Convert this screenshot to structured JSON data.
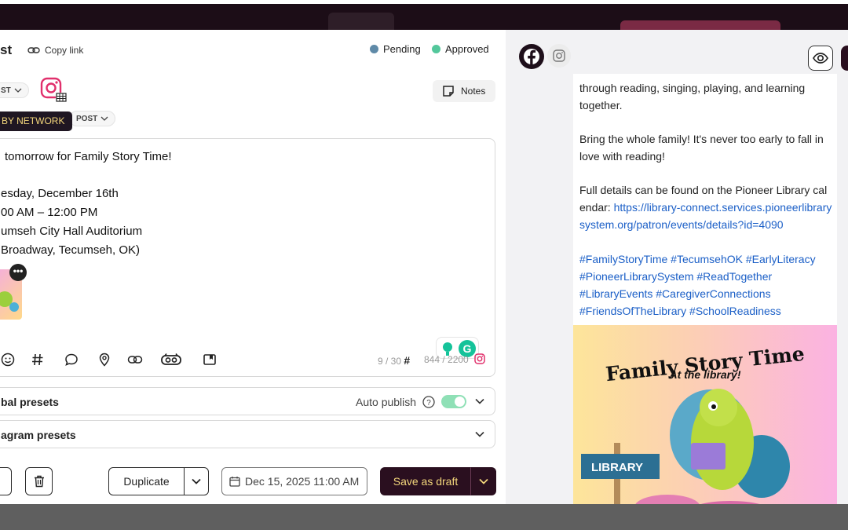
{
  "header": {
    "title_fragment": "st",
    "copy_link": "Copy link",
    "statuses": [
      {
        "label": "Pending",
        "color": "#5f8aa8"
      },
      {
        "label": "Approved",
        "color": "#53c79b"
      }
    ]
  },
  "network_row": {
    "chip_left": "ST",
    "chip_post": "POST",
    "notes": "Notes",
    "tooltip": "BY NETWORK"
  },
  "editor": {
    "lines": [
      "tomorrow for Family Story Time!",
      "esday, December 16th",
      "00 AM – 12:00 PM",
      "umseh City Hall Auditorium",
      "Broadway, Tecumseh, OK)"
    ],
    "hashtag_count": "9 / 30",
    "char_count": "844 / 2200",
    "toolbar_icons": [
      "emoji-icon",
      "hashtag-icon",
      "comment-icon",
      "location-icon",
      "link-icon",
      "ai-assistant-icon",
      "media-library-icon"
    ]
  },
  "presets": {
    "global_label": "bal presets",
    "auto_publish": "Auto publish",
    "auto_publish_on": true,
    "instagram_label": "agram presets"
  },
  "footer": {
    "duplicate": "Duplicate",
    "date": "Dec 15, 2025 11:00 AM",
    "save_draft": "Save as draft"
  },
  "preview": {
    "networks": [
      "facebook-icon",
      "instagram-icon"
    ],
    "para1": "through reading, singing, playing, and learning together.",
    "para2": "Bring the whole family! It's never too early to fall in love with reading!",
    "para3_prefix": "Full details can be found on the Pioneer Library calendar: ",
    "para3_link": "https://library-connect.services.pioneerlibrarysystem.org/patron/events/details?id=4090",
    "hashtags": "#FamilyStoryTime #TecumsehOK #EarlyLiteracy #PioneerLibrarySystem #ReadTogether #LibraryEvents #CaregiverConnections #FriendsOfTheLibrary #SchoolReadiness",
    "image_title": "Family Story Time",
    "image_subtitle": "At the library!",
    "image_sign": "LIBRARY"
  }
}
